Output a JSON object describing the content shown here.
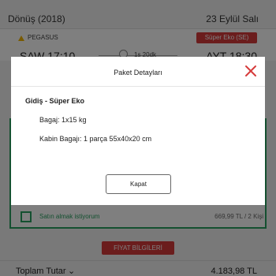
{
  "background": {
    "header": {
      "title": "Dönüş (2018)",
      "date": "23 Eylül Salı"
    },
    "flight": {
      "airline": "PEGASUS",
      "fare_class": "Süper Eko (SE)",
      "departure": "SAW 17:10",
      "arrival": "AYT 18:30",
      "duration": "1s 20dk"
    },
    "package_option": {
      "label": "Satın almak istiyorum",
      "price": "669,99 TL / 2 Kişi"
    },
    "price_info_button": "FİYAT BİLGİLERİ",
    "total": {
      "label": "Toplam Tutar",
      "value": "4.183,98 TL"
    }
  },
  "modal": {
    "title": "Paket Detayları",
    "section_title": "Gidiş - Süper Eko",
    "baggage": "Bagaj: 1x15 kg",
    "cabin_baggage": "Kabin Bagajı: 1 parça 55x40x20 cm",
    "close_button": "Kapat"
  },
  "colors": {
    "accent_red": "#d63b3b",
    "accent_green": "#28a060",
    "overlay": "rgba(0,0,0,0.5)"
  },
  "icons": {
    "close": "close-icon",
    "clock": "clock-icon",
    "chevron": "chevron-down-icon",
    "airline": "airline-logo-icon"
  }
}
